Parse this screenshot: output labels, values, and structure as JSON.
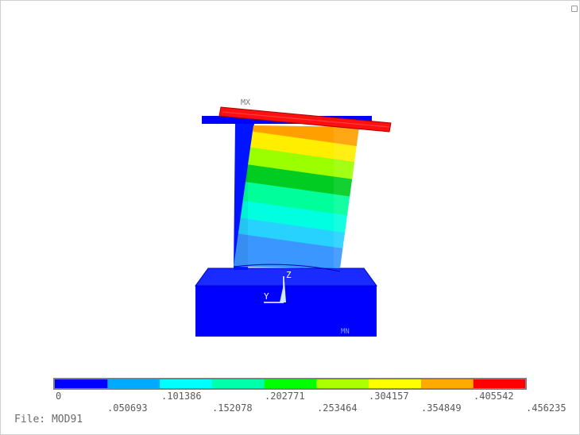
{
  "plot": {
    "max_marker": "MX",
    "min_marker": "MN",
    "triad": {
      "z_label": "Z",
      "y_label": "Y"
    }
  },
  "legend": {
    "colors": [
      "#0000ff",
      "#00aaff",
      "#00ffff",
      "#00ffaa",
      "#00ff00",
      "#aaff00",
      "#ffff00",
      "#ffaa00",
      "#ff0000"
    ],
    "top_labels": [
      "0",
      ".101386",
      ".202771",
      ".304157",
      ".405542"
    ],
    "bottom_labels": [
      ".050693",
      ".152078",
      ".253464",
      ".354849",
      ".456235"
    ]
  },
  "footer": {
    "file_label": "File: MOD91"
  }
}
